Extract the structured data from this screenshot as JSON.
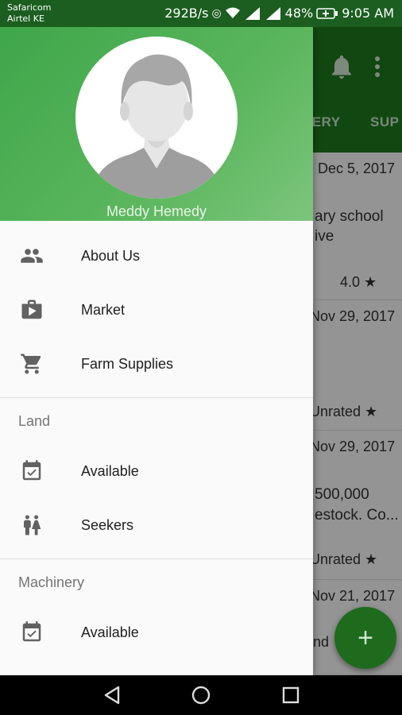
{
  "status_bar": {
    "carrier_1": "Safaricom",
    "carrier_2": "Airtel KE",
    "speed": "292B/s",
    "battery": "48%",
    "time": "9:05 AM"
  },
  "background": {
    "tabs": [
      "HERY",
      "SUP"
    ],
    "cards": [
      {
        "date": "Dec 5, 2017",
        "line1": "ary school",
        "line2": "ive",
        "rating": "4.0 ★"
      },
      {
        "date": "Nov 29, 2017",
        "line1": "",
        "line2": "",
        "rating": "Unrated ★"
      },
      {
        "date": "Nov 29, 2017",
        "line1": "500,000",
        "line2": "estock. Co...",
        "rating": "Unrated ★"
      },
      {
        "date": "Nov 21, 2017",
        "line1": "nd",
        "line2": "",
        "rating": ""
      }
    ],
    "fab_label": "+"
  },
  "drawer": {
    "user_name": "Meddy Hemedy",
    "items": [
      {
        "label": "About Us",
        "icon": "people-icon"
      },
      {
        "label": "Market",
        "icon": "shop-icon"
      },
      {
        "label": "Farm Supplies",
        "icon": "cart-icon"
      }
    ],
    "sections": [
      {
        "title": "Land",
        "items": [
          {
            "label": "Available",
            "icon": "event-available-icon"
          },
          {
            "label": "Seekers",
            "icon": "wc-icon"
          }
        ]
      },
      {
        "title": "Machinery",
        "items": [
          {
            "label": "Available",
            "icon": "event-available-icon"
          }
        ]
      }
    ]
  },
  "colors": {
    "primary": "#1e7a1e",
    "header_gradient_start": "#3fa64a",
    "header_gradient_end": "#7cc57c",
    "icon": "#616161"
  }
}
